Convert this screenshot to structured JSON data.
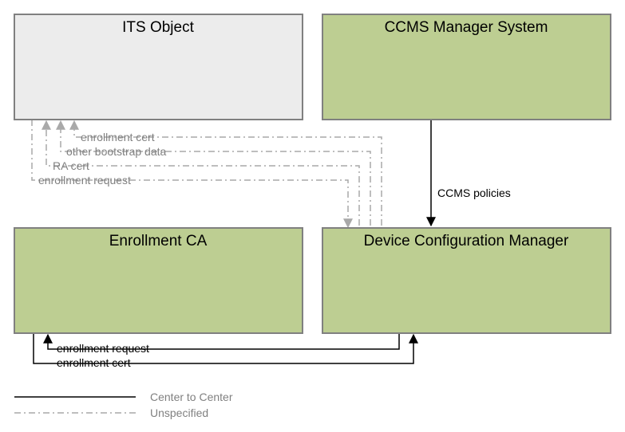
{
  "boxes": {
    "its_object": {
      "label": "ITS Object",
      "fill": "#ececec",
      "stroke": "#808080"
    },
    "ccms_manager": {
      "label": "CCMS Manager System",
      "fill": "#bdce92",
      "stroke": "#808080"
    },
    "enrollment_ca": {
      "label": "Enrollment CA",
      "fill": "#bdce92",
      "stroke": "#808080"
    },
    "dcm": {
      "label": "Device Configuration Manager",
      "fill": "#bdce92",
      "stroke": "#808080"
    }
  },
  "edges": {
    "ccms_policies": "CCMS policies",
    "enrollment_request_bottom": "enrollment request",
    "enrollment_cert_bottom": "enrollment cert",
    "enrollment_cert_top": "enrollment cert",
    "other_bootstrap_data": "other bootstrap data",
    "ra_cert": "RA cert",
    "enrollment_request_top": "enrollment request"
  },
  "legend": {
    "c2c": "Center to Center",
    "unspecified": "Unspecified"
  }
}
